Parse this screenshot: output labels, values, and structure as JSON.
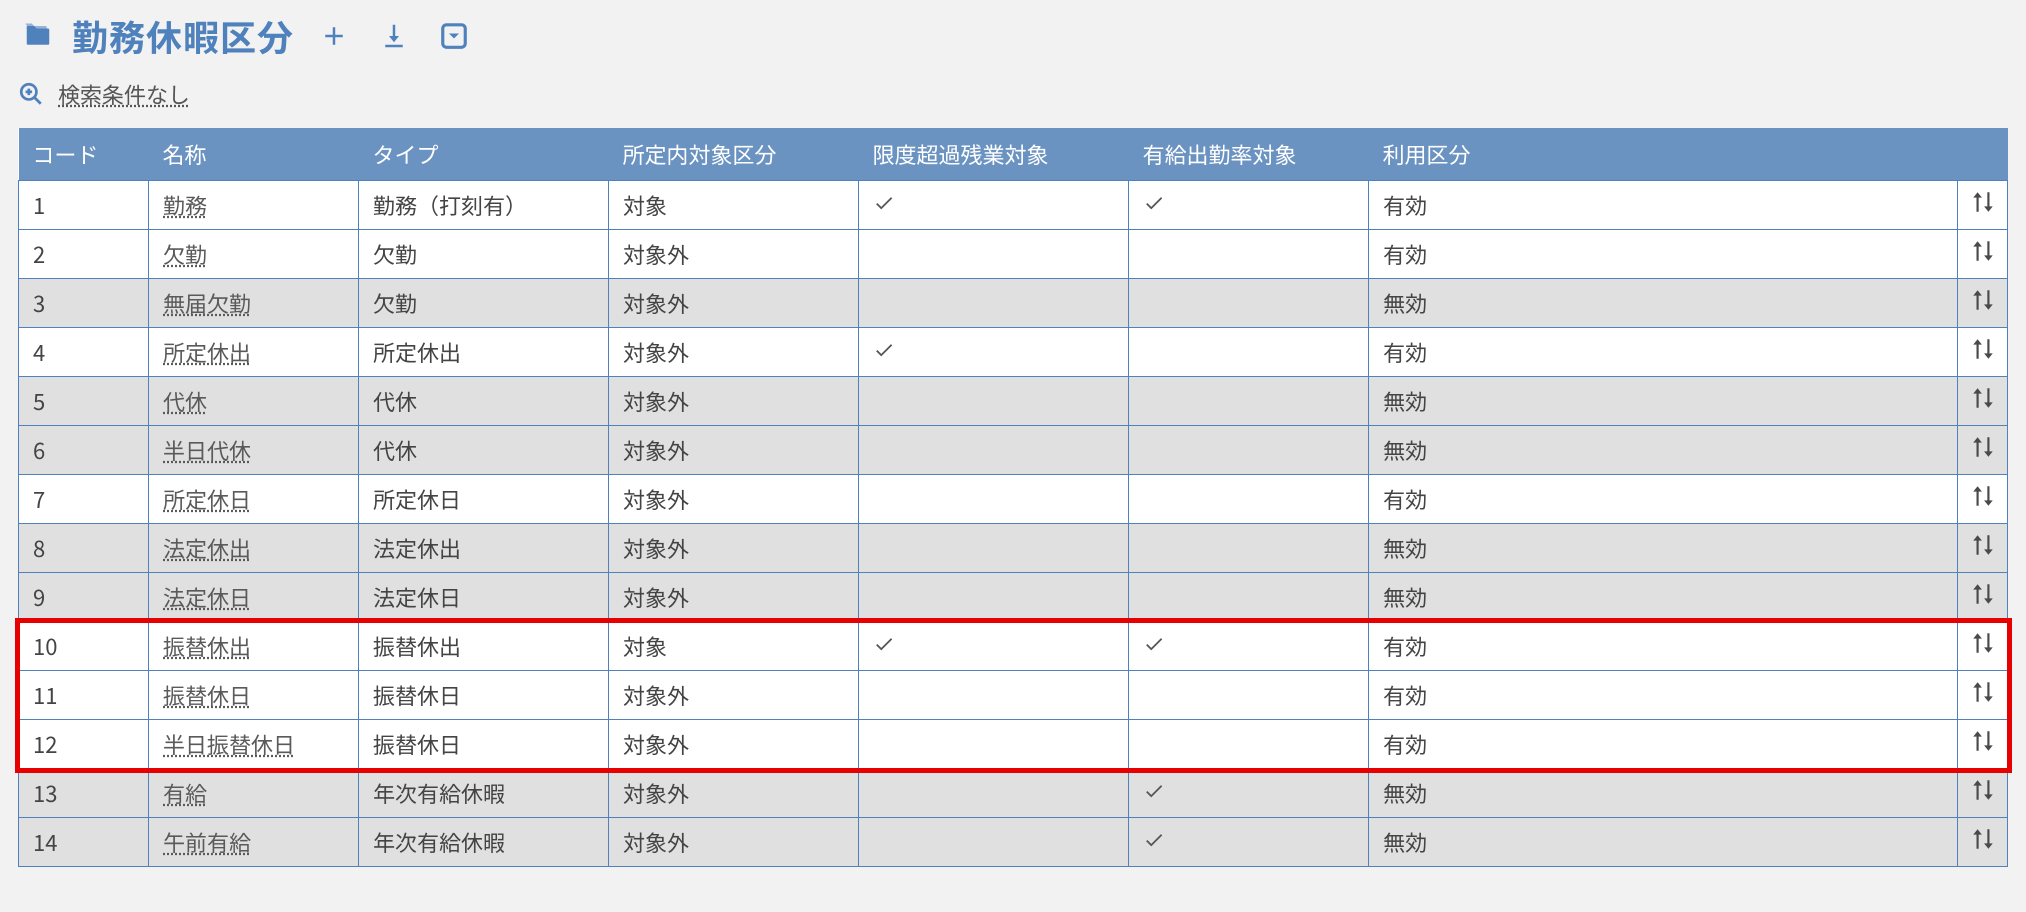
{
  "header": {
    "title": "勤務休暇区分"
  },
  "search": {
    "label": "検索条件なし"
  },
  "columns": {
    "code": "コード",
    "name": "名称",
    "type": "タイプ",
    "scope": "所定内対象区分",
    "over": "限度超過残業対象",
    "paid": "有給出勤率対象",
    "use": "利用区分"
  },
  "rows": [
    {
      "code": "1",
      "name": "勤務",
      "type": "勤務（打刻有）",
      "scope": "対象",
      "over": true,
      "paid": true,
      "use": "有効",
      "disabled": false
    },
    {
      "code": "2",
      "name": "欠勤",
      "type": "欠勤",
      "scope": "対象外",
      "over": false,
      "paid": false,
      "use": "有効",
      "disabled": false
    },
    {
      "code": "3",
      "name": "無届欠勤",
      "type": "欠勤",
      "scope": "対象外",
      "over": false,
      "paid": false,
      "use": "無効",
      "disabled": true
    },
    {
      "code": "4",
      "name": "所定休出",
      "type": "所定休出",
      "scope": "対象外",
      "over": true,
      "paid": false,
      "use": "有効",
      "disabled": false
    },
    {
      "code": "5",
      "name": "代休",
      "type": "代休",
      "scope": "対象外",
      "over": false,
      "paid": false,
      "use": "無効",
      "disabled": true
    },
    {
      "code": "6",
      "name": "半日代休",
      "type": "代休",
      "scope": "対象外",
      "over": false,
      "paid": false,
      "use": "無効",
      "disabled": true
    },
    {
      "code": "7",
      "name": "所定休日",
      "type": "所定休日",
      "scope": "対象外",
      "over": false,
      "paid": false,
      "use": "有効",
      "disabled": false
    },
    {
      "code": "8",
      "name": "法定休出",
      "type": "法定休出",
      "scope": "対象外",
      "over": false,
      "paid": false,
      "use": "無効",
      "disabled": true
    },
    {
      "code": "9",
      "name": "法定休日",
      "type": "法定休日",
      "scope": "対象外",
      "over": false,
      "paid": false,
      "use": "無効",
      "disabled": true
    },
    {
      "code": "10",
      "name": "振替休出",
      "type": "振替休出",
      "scope": "対象",
      "over": true,
      "paid": true,
      "use": "有効",
      "disabled": false
    },
    {
      "code": "11",
      "name": "振替休日",
      "type": "振替休日",
      "scope": "対象外",
      "over": false,
      "paid": false,
      "use": "有効",
      "disabled": false
    },
    {
      "code": "12",
      "name": "半日振替休日",
      "type": "振替休日",
      "scope": "対象外",
      "over": false,
      "paid": false,
      "use": "有効",
      "disabled": false
    },
    {
      "code": "13",
      "name": "有給",
      "type": "年次有給休暇",
      "scope": "対象外",
      "over": false,
      "paid": true,
      "use": "無効",
      "disabled": true
    },
    {
      "code": "14",
      "name": "午前有給",
      "type": "年次有給休暇",
      "scope": "対象外",
      "over": false,
      "paid": true,
      "use": "無効",
      "disabled": true
    }
  ],
  "highlight": {
    "start_code": "10",
    "end_code": "12"
  }
}
